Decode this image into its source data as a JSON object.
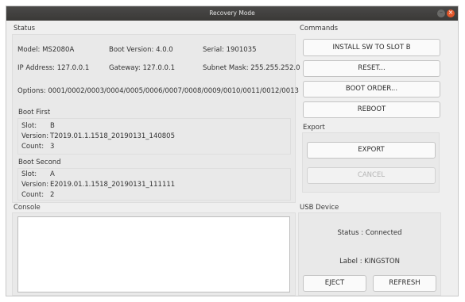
{
  "window": {
    "title": "Recovery Mode",
    "minimize_glyph": "–",
    "close_glyph": "×"
  },
  "status": {
    "title": "Status",
    "model": "Model: MS2080A",
    "boot_version": "Boot Version: 4.0.0",
    "serial": "Serial: 1901035",
    "ip": "IP Address: 127.0.0.1",
    "gateway": "Gateway: 127.0.0.1",
    "subnet": "Subnet Mask: 255.255.252.0",
    "options": "Options: 0001/0002/0003/0004/0005/0006/0007/0008/0009/0010/0011/0012/0013",
    "boot_first": {
      "title": "Boot First",
      "slot_label": "Slot:",
      "slot_value": "B",
      "version_label": "Version:",
      "version_value": "T2019.01.1.1518_20190131_140805",
      "count_label": "Count:",
      "count_value": "3"
    },
    "boot_second": {
      "title": "Boot Second",
      "slot_label": "Slot:",
      "slot_value": "A",
      "version_label": "Version:",
      "version_value": "E2019.01.1.1518_20190131_111111",
      "count_label": "Count:",
      "count_value": "2"
    }
  },
  "commands": {
    "title": "Commands",
    "install": "INSTALL SW TO SLOT B",
    "reset": "RESET...",
    "boot_order": "BOOT ORDER...",
    "reboot": "REBOOT"
  },
  "export": {
    "title": "Export",
    "export": "EXPORT",
    "cancel": "CANCEL"
  },
  "console": {
    "title": "Console",
    "content": ""
  },
  "usb": {
    "title": "USB Device",
    "status": "Status : Connected",
    "label": "Label : KINGSTON",
    "eject": "EJECT",
    "refresh": "REFRESH"
  }
}
